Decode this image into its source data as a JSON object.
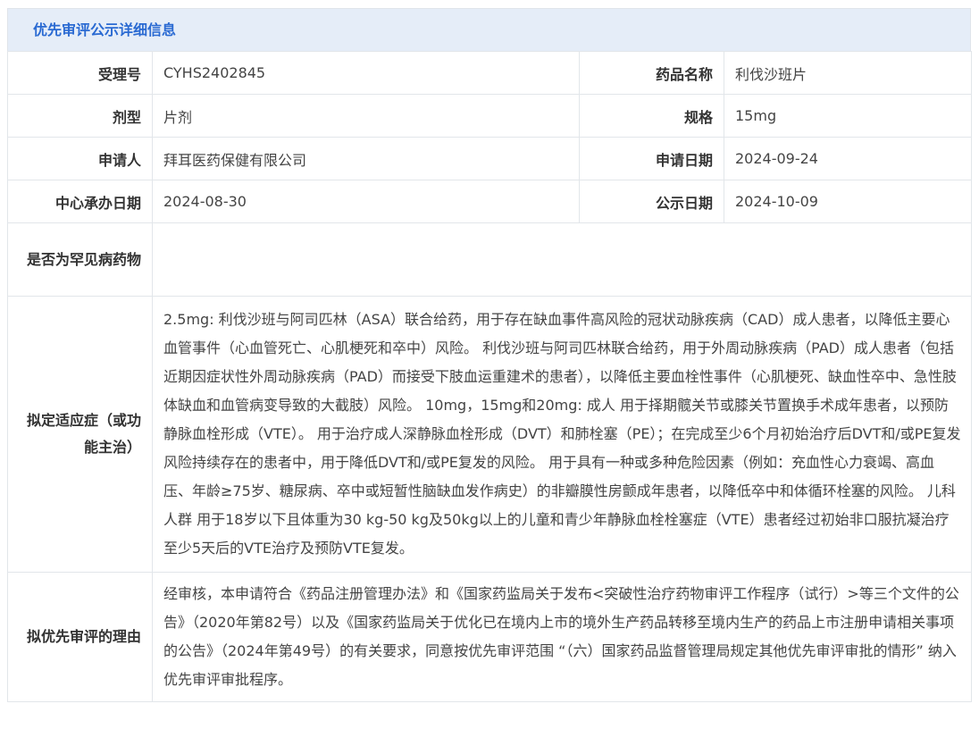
{
  "header": {
    "title": "优先审评公示详细信息"
  },
  "rows": {
    "acceptance_no": {
      "label": "受理号",
      "value": "CYHS2402845"
    },
    "drug_name": {
      "label": "药品名称",
      "value": "利伐沙班片"
    },
    "dosage_form": {
      "label": "剂型",
      "value": "片剂"
    },
    "specification": {
      "label": "规格",
      "value": "15mg"
    },
    "applicant": {
      "label": "申请人",
      "value": "拜耳医药保健有限公司"
    },
    "apply_date": {
      "label": "申请日期",
      "value": "2024-09-24"
    },
    "center_date": {
      "label": "中心承办日期",
      "value": "2024-08-30"
    },
    "publish_date": {
      "label": "公示日期",
      "value": "2024-10-09"
    },
    "rare_disease": {
      "label": "是否为罕见病药物",
      "value": ""
    },
    "indication": {
      "label": "拟定适应症（或功能主治）",
      "value": "2.5mg: 利伐沙班与阿司匹林（ASA）联合给药，用于存在缺血事件高风险的冠状动脉疾病（CAD）成人患者，以降低主要心血管事件（心血管死亡、心肌梗死和卒中）风险。 利伐沙班与阿司匹林联合给药，用于外周动脉疾病（PAD）成人患者（包括近期因症状性外周动脉疾病（PAD）而接受下肢血运重建术的患者），以降低主要血栓性事件（心肌梗死、缺血性卒中、急性肢体缺血和血管病变导致的大截肢）风险。 10mg，15mg和20mg: 成人 用于择期髋关节或膝关节置换手术成年患者，以预防静脉血栓形成（VTE）。 用于治疗成人深静脉血栓形成（DVT）和肺栓塞（PE）；在完成至少6个月初始治疗后DVT和/或PE复发风险持续存在的患者中，用于降低DVT和/或PE复发的风险。 用于具有一种或多种危险因素（例如：充血性心力衰竭、高血压、年龄≥75岁、糖尿病、卒中或短暂性脑缺血发作病史）的非瓣膜性房颤成年患者，以降低卒中和体循环栓塞的风险。 儿科人群 用于18岁以下且体重为30 kg-50 kg及50kg以上的儿童和青少年静脉血栓栓塞症（VTE）患者经过初始非口服抗凝治疗至少5天后的VTE治疗及预防VTE复发。"
    },
    "reason": {
      "label": "拟优先审评的理由",
      "value": "经审核，本申请符合《药品注册管理办法》和《国家药监局关于发布<突破性治疗药物审评工作程序（试行）>等三个文件的公告》（2020年第82号）以及《国家药监局关于优化已在境内上市的境外生产药品转移至境内生产的药品上市注册申请相关事项的公告》（2024年第49号）的有关要求，同意按优先审评范围 “（六）国家药品监督管理局规定其他优先审评审批的情形” 纳入优先审评审批程序。"
    }
  }
}
